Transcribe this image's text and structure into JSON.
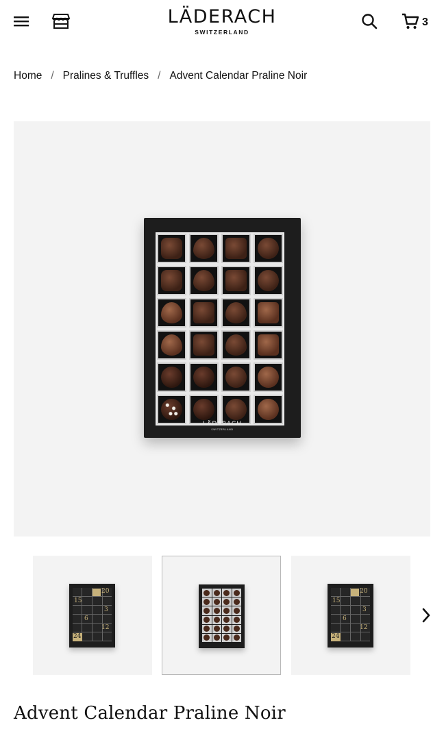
{
  "header": {
    "menu_icon": "hamburger-menu-icon",
    "store_icon": "storefront-icon",
    "logo_main": "LÄDERACH",
    "logo_sub": "SWITZERLAND",
    "search_icon": "search-icon",
    "cart_icon": "cart-icon",
    "cart_count": "3"
  },
  "breadcrumb": {
    "items": [
      "Home",
      "Pralines & Truffles",
      "Advent Calendar Praline Noir"
    ],
    "separator": "/"
  },
  "gallery": {
    "box_brand": "LÄDERACH",
    "box_brand_sub": "SWITZERLAND",
    "thumbnail_numbers": [
      "20",
      "15",
      "3",
      "6",
      "12",
      "24"
    ],
    "next_icon": "chevron-right-icon",
    "selected_index": 1
  },
  "product": {
    "title": "Advent Calendar Praline Noir"
  },
  "colors": {
    "background": "#ffffff",
    "image_bg": "#f3f3f3",
    "box": "#1d1d1d",
    "gold": "#c7b27b",
    "text": "#111111"
  }
}
